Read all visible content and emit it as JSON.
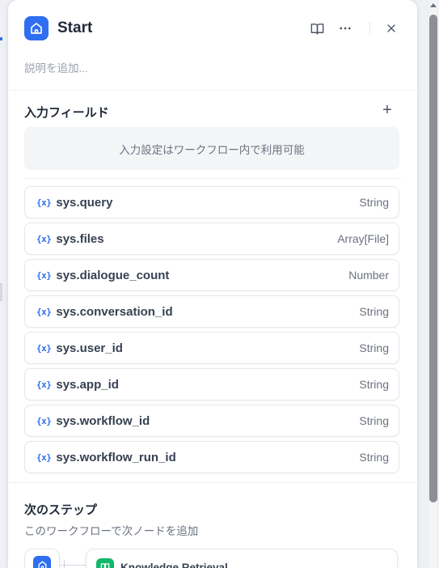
{
  "panel": {
    "title": "Start",
    "description_placeholder": "説明を追加..."
  },
  "input_fields": {
    "title": "入力フィールド",
    "add_label": "+",
    "info": "入力設定はワークフロー内で利用可能"
  },
  "variables": [
    {
      "name": "sys.query",
      "type": "String"
    },
    {
      "name": "sys.files",
      "type": "Array[File]"
    },
    {
      "name": "sys.dialogue_count",
      "type": "Number"
    },
    {
      "name": "sys.conversation_id",
      "type": "String"
    },
    {
      "name": "sys.user_id",
      "type": "String"
    },
    {
      "name": "sys.app_id",
      "type": "String"
    },
    {
      "name": "sys.workflow_id",
      "type": "String"
    },
    {
      "name": "sys.workflow_run_id",
      "type": "String"
    }
  ],
  "variable_icon_text": "{x}",
  "next_step": {
    "title": "次のステップ",
    "subtitle": "このワークフローで次ノードを追加",
    "node_label": "Knowledge Retrieval"
  },
  "colors": {
    "accent": "#2f6ef0",
    "knowledge": "#12b76a"
  },
  "icons": [
    "home-icon",
    "book-icon",
    "more-icon",
    "close-icon",
    "plus-icon",
    "variable-icon",
    "knowledge-icon"
  ]
}
